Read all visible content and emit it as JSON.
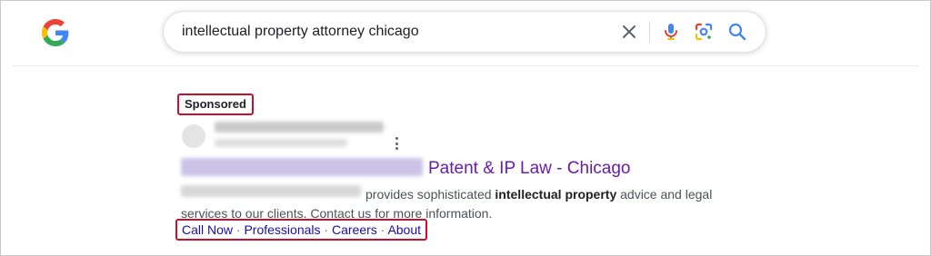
{
  "search": {
    "query": "intellectual property attorney chicago"
  },
  "ad": {
    "sponsored_label": "Sponsored",
    "title_visible": "Patent & IP Law - Chicago",
    "description_line1_plain": "provides sophisticated ",
    "description_line1_bold": "intellectual property",
    "description_line1_end": " advice and legal",
    "description_line2": "services to our clients. Contact us for more information.",
    "sitelinks": [
      "Call Now",
      "Professionals",
      "Careers",
      "About"
    ],
    "sitelink_separator": " · ",
    "highlight_color": "#c8102e",
    "title_color": "#681da8",
    "link_color": "#1a0dab"
  }
}
